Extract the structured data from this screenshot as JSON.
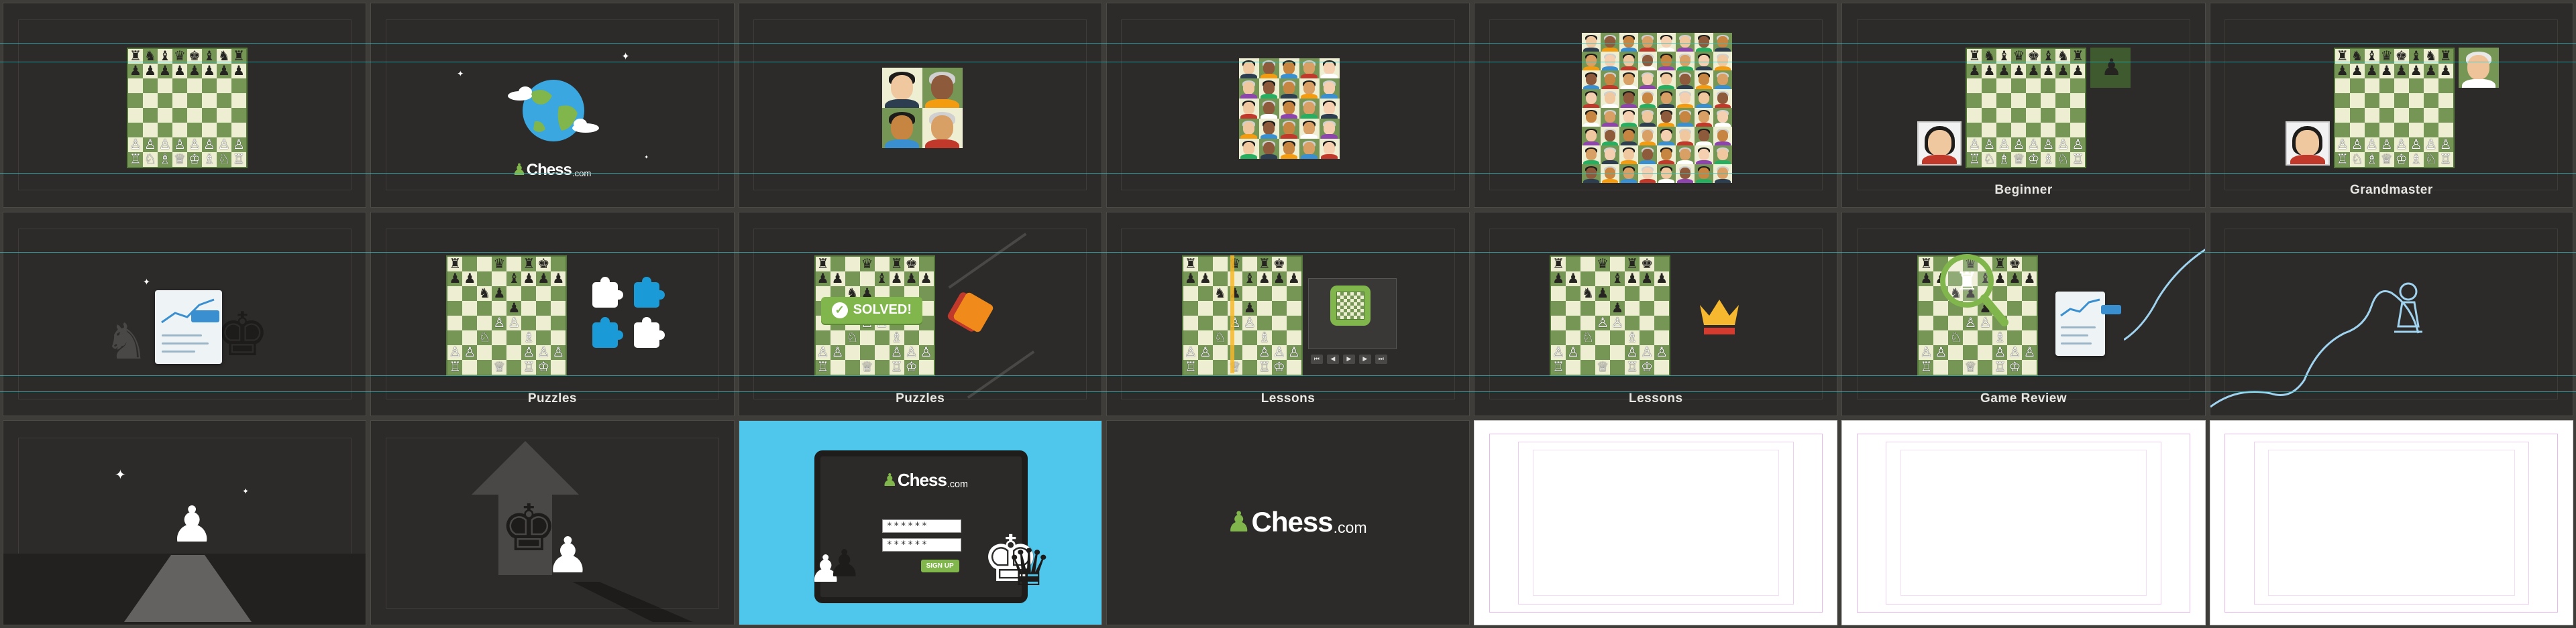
{
  "captions": {
    "beginner": "Beginner",
    "grandmaster": "Grandmaster",
    "puzzles": "Puzzles",
    "lessons": "Lessons",
    "game_review": "Game Review"
  },
  "logo": {
    "word": "Chess",
    "domain": ".com"
  },
  "puzzle": {
    "solved": "SOLVED!"
  },
  "login": {
    "password_mask": "******",
    "confirm_mask": "******",
    "signup": "SIGN UP"
  },
  "colors": {
    "background": "#2d2b29",
    "board_light": "#eeeed2",
    "board_dark": "#769656",
    "brand_green": "#81b64c",
    "cyan_panel": "#4fc7ec",
    "puzzle_blue": "#1a9bd7",
    "crown_gold": "#f5b82e"
  },
  "icons": {
    "globe": "globe-icon",
    "puzzle": "puzzle-piece-icon",
    "crown": "crown-icon",
    "magnifier": "magnifier-icon",
    "checkmark": "checkmark-icon",
    "pawn": "pawn-icon",
    "king": "king-icon",
    "star": "star-icon"
  }
}
